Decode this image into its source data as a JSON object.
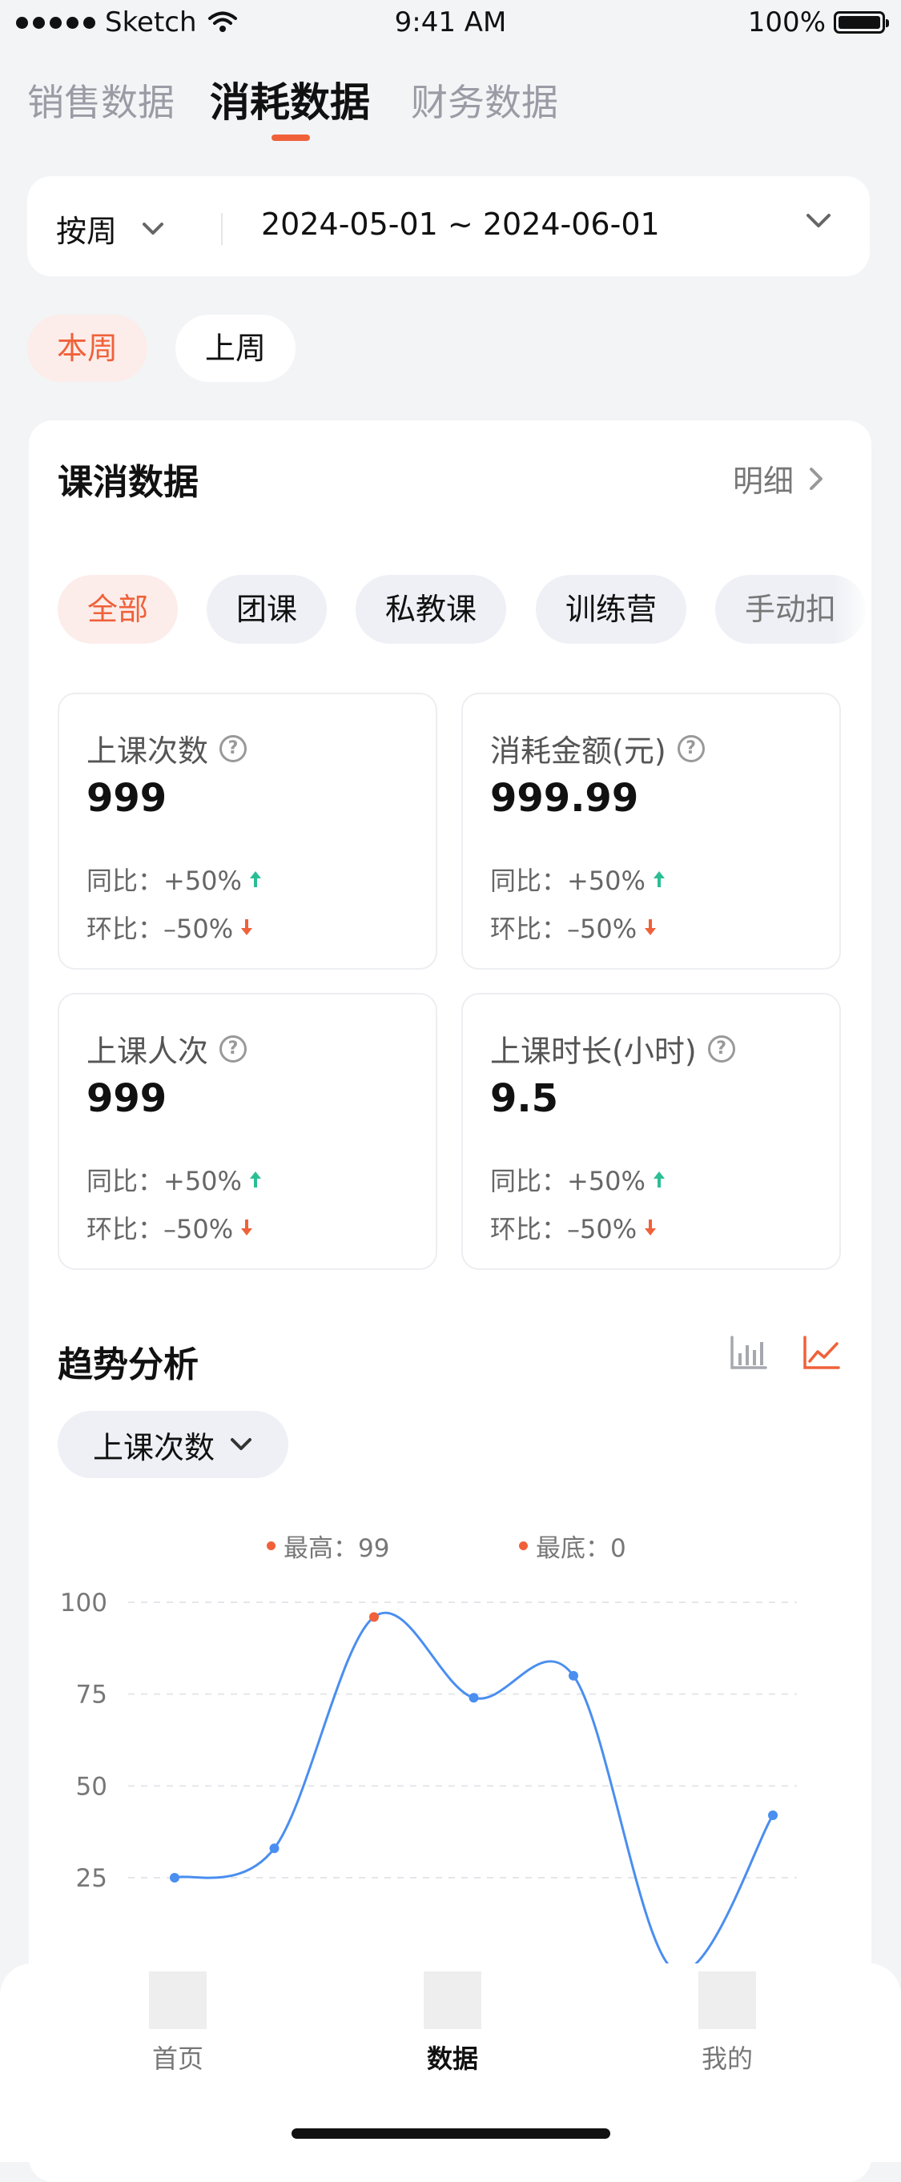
{
  "status_bar": {
    "carrier": "Sketch",
    "time": "9:41 AM",
    "battery": "100%"
  },
  "top_tabs": [
    {
      "label": "销售数据",
      "active": false
    },
    {
      "label": "消耗数据",
      "active": true
    },
    {
      "label": "财务数据",
      "active": false
    }
  ],
  "filter": {
    "period": "按周",
    "date_range": "2024-05-01 ~ 2024-06-01"
  },
  "week_chips": [
    {
      "label": "本周",
      "active": true
    },
    {
      "label": "上周",
      "active": false
    }
  ],
  "consumption": {
    "title": "课消数据",
    "detail_link": "明细",
    "categories": [
      {
        "label": "全部",
        "active": true
      },
      {
        "label": "团课",
        "active": false
      },
      {
        "label": "私教课",
        "active": false
      },
      {
        "label": "训练营",
        "active": false
      },
      {
        "label": "手动扣",
        "active": false
      }
    ],
    "stats": [
      {
        "label": "上课次数",
        "value": "999",
        "yoy": "同比：+50%",
        "mom": "环比：–50%"
      },
      {
        "label": "消耗金额(元)",
        "value": "999.99",
        "yoy": "同比：+50%",
        "mom": "环比：–50%"
      },
      {
        "label": "上课人次",
        "value": "999",
        "yoy": "同比：+50%",
        "mom": "环比：–50%"
      },
      {
        "label": "上课时长(小时)",
        "value": "9.5",
        "yoy": "同比：+50%",
        "mom": "环比：–50%"
      }
    ]
  },
  "trend": {
    "title": "趋势分析",
    "metric": "上课次数",
    "legend_max": "最高：99",
    "legend_min": "最底：0",
    "view_icons": [
      "bar-chart-icon",
      "line-chart-icon"
    ],
    "active_view": "line-chart-icon"
  },
  "chart_data": {
    "type": "line",
    "y_ticks": [
      "100",
      "75",
      "50",
      "25"
    ],
    "ylim": [
      0,
      100
    ],
    "grid": true,
    "series": [
      {
        "values": [
          25,
          33,
          96,
          74,
          80,
          0,
          42
        ],
        "max_index": 2
      }
    ]
  },
  "colors": {
    "accent": "#F0613A",
    "line": "#4A8EF0",
    "up": "#2BBE95",
    "down": "#F0613A",
    "pill_bg": "#EEF0F5"
  },
  "tab_bar": [
    {
      "label": "首页",
      "active": false
    },
    {
      "label": "数据",
      "active": true
    },
    {
      "label": "我的",
      "active": false
    }
  ]
}
